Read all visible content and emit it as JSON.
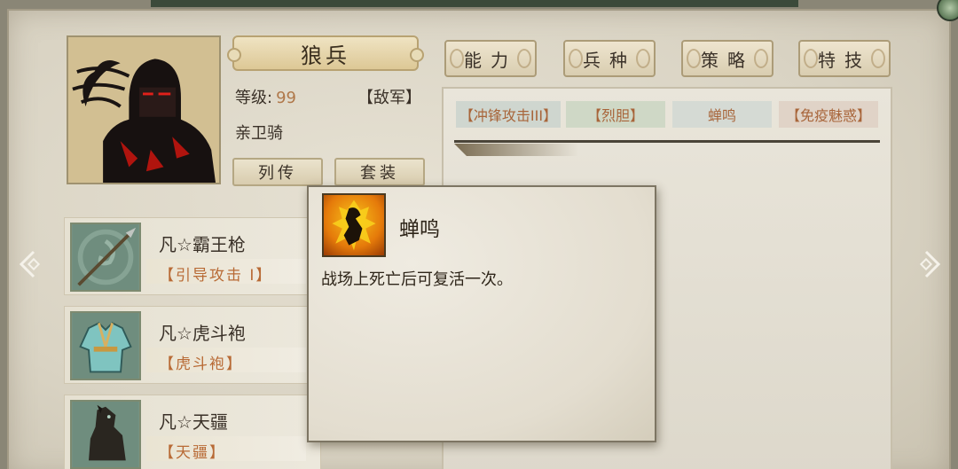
{
  "hero": {
    "name": "狼兵",
    "level_label": "等级:",
    "level_value": "99",
    "faction": "【敌军】",
    "unit_type": "亲卫骑",
    "buttons": {
      "biography": "列传",
      "outfit": "套装"
    }
  },
  "tabs": [
    {
      "label": "能力"
    },
    {
      "label": "兵种"
    },
    {
      "label": "策略"
    },
    {
      "label": "特技"
    }
  ],
  "skills": [
    {
      "label": "【冲锋攻击III】"
    },
    {
      "label": "【烈胆】"
    },
    {
      "label": "蝉鸣"
    },
    {
      "label": "【免疫魅惑】"
    }
  ],
  "equipment": [
    {
      "name": "凡☆霸王枪",
      "effect": "【引导攻击 Ⅰ】",
      "icon": "spear-icon"
    },
    {
      "name": "凡☆虎斗袍",
      "effect": "【虎斗袍】",
      "icon": "robe-icon"
    },
    {
      "name": "凡☆天疆",
      "effect": "【天疆】",
      "icon": "horse-icon"
    }
  ],
  "tooltip": {
    "title": "蝉鸣",
    "description": "战场上死亡后可复活一次。",
    "icon": "flame-figure-icon"
  },
  "colors": {
    "accent_orange": "#b86a35",
    "level_value": "#b0784a",
    "panel_border": "#ac9c78"
  }
}
